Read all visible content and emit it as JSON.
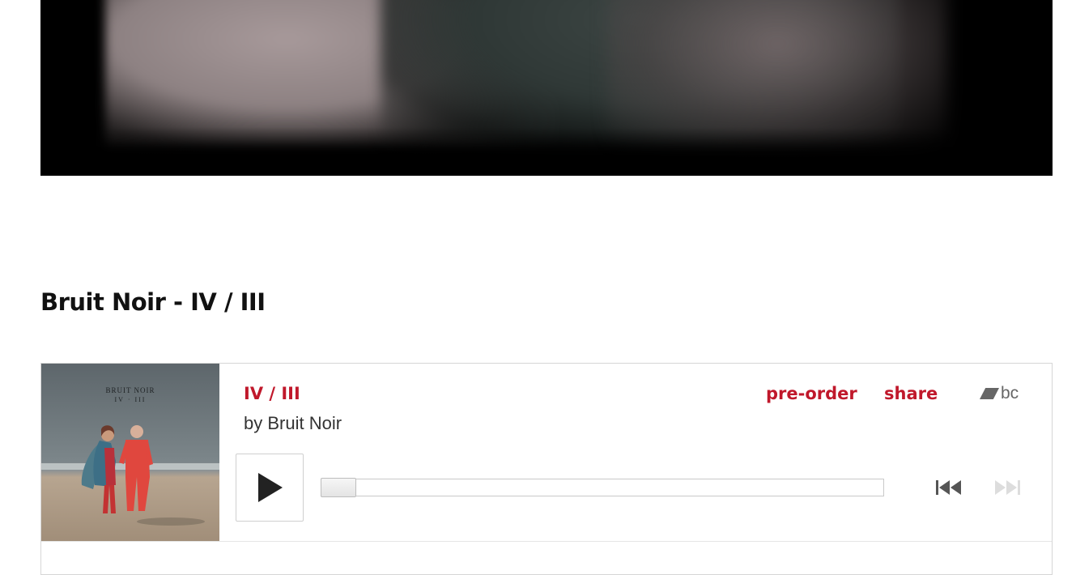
{
  "section": {
    "title": "Bruit Noir - IV / III"
  },
  "player": {
    "track_title": "IV / III",
    "artist_line": "by Bruit Noir",
    "preorder_label": "pre-order",
    "share_label": "share",
    "logo_text": "bc",
    "album_art_title": "BRUIT NOIR",
    "album_art_subtitle": "IV · III",
    "progress_fraction": 0,
    "icons": {
      "play": "play-icon",
      "previous": "previous-track-icon",
      "next": "next-track-icon",
      "logo": "bandcamp-logo-icon"
    }
  },
  "colors": {
    "accent": "#c0182b",
    "text": "#333333",
    "icon": "#555555",
    "icon_disabled": "#dddddd"
  }
}
